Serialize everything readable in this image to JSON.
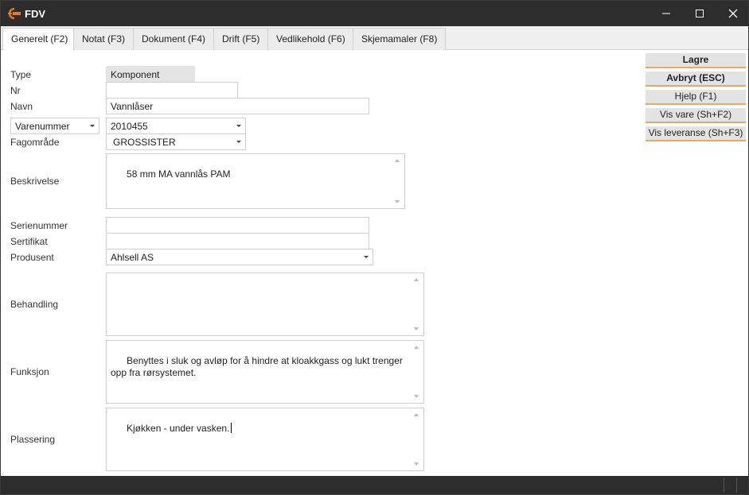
{
  "window": {
    "title": "FDV",
    "app_icon": "fdv-logo-icon",
    "accent_color": "#e8791f"
  },
  "tabs": [
    {
      "label": "Generelt (F2)",
      "active": true
    },
    {
      "label": "Notat (F3)"
    },
    {
      "label": "Dokument (F4)"
    },
    {
      "label": "Drift (F5)"
    },
    {
      "label": "Vedlikehold (F6)"
    },
    {
      "label": "Skjemamaler (F8)"
    }
  ],
  "form": {
    "type": {
      "label": "Type",
      "value": "Komponent"
    },
    "nr": {
      "label": "Nr",
      "value": ""
    },
    "navn": {
      "label": "Navn",
      "value": "Vannlåser"
    },
    "varenummer": {
      "selector": "Varenummer",
      "value": "2010455"
    },
    "fagomrade": {
      "label": "Fagområde",
      "value": "GROSSISTER"
    },
    "beskrivelse": {
      "label": "Beskrivelse",
      "value": "58 mm MA vannlås PAM"
    },
    "serienummer": {
      "label": "Serienummer",
      "value": ""
    },
    "sertifikat": {
      "label": "Sertifikat",
      "value": ""
    },
    "produsent": {
      "label": "Produsent",
      "value": "Ahlsell AS"
    },
    "behandling": {
      "label": "Behandling",
      "value": ""
    },
    "funksjon": {
      "label": "Funksjon",
      "value": "Benyttes i sluk og avløp for å hindre at kloakkgass og lukt trenger opp fra rørsystemet."
    },
    "plassering": {
      "label": "Plassering",
      "value": "Kjøkken - under vasken."
    }
  },
  "actions": {
    "save": "Lagre",
    "cancel": "Avbryt (ESC)",
    "help": "Hjelp (F1)",
    "show_item": "Vis vare (Sh+F2)",
    "show_delivery": "Vis leveranse (Sh+F3)"
  }
}
